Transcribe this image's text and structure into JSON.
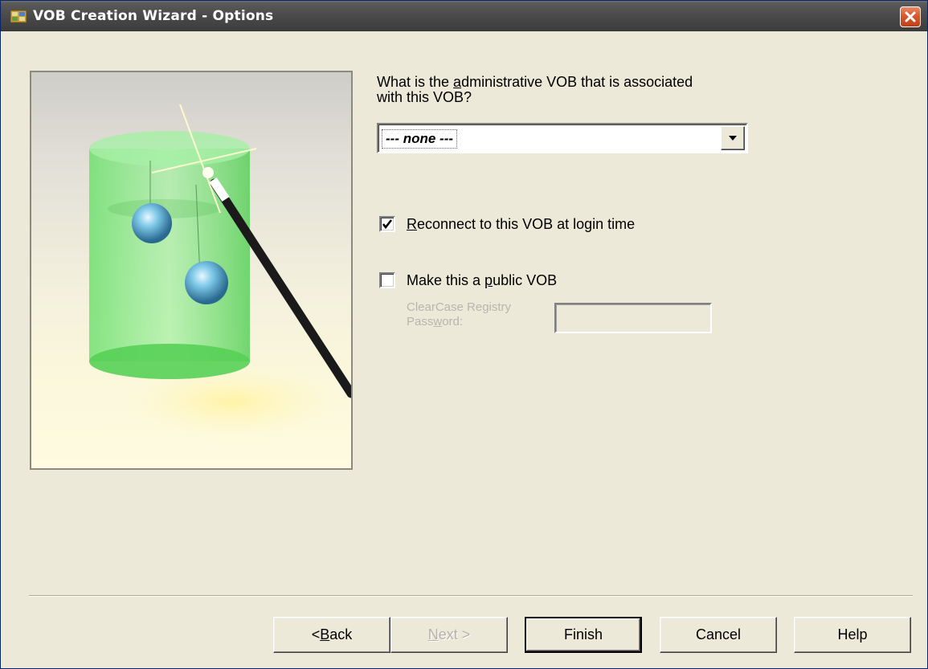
{
  "window": {
    "title": "VOB Creation Wizard - Options"
  },
  "icons": {
    "title": "wizard-app-icon",
    "close": "close-icon",
    "dropdown": "chevron-down-icon",
    "check": "checkmark-icon"
  },
  "admin_vob": {
    "question_pre": "What is the ",
    "question_ul": "a",
    "question_post": "dministrative VOB that is associated",
    "question_line2": "with this VOB?",
    "selected_value": "--- none ---"
  },
  "reconnect": {
    "label_ul": "R",
    "label_rest": "econnect to this VOB at login time",
    "checked": true
  },
  "public_vob": {
    "label_pre": "Make this a ",
    "label_ul": "p",
    "label_post": "ublic VOB",
    "checked": false,
    "registry_label_line1": "ClearCase Registry",
    "registry_label_line2_pre": "Pass",
    "registry_label_line2_ul": "w",
    "registry_label_line2_post": "ord:",
    "password_value": ""
  },
  "buttons": {
    "back_pre": "< ",
    "back_ul": "B",
    "back_post": "ack",
    "next_ul": "N",
    "next_post": "ext >",
    "finish": "Finish",
    "cancel": "Cancel",
    "help": "Help"
  },
  "colors": {
    "dialog_bg": "#ece9d8",
    "titlebar": "#4a4a4a",
    "close_button": "#d75a2e",
    "disabled_text": "#b8b6ae"
  }
}
